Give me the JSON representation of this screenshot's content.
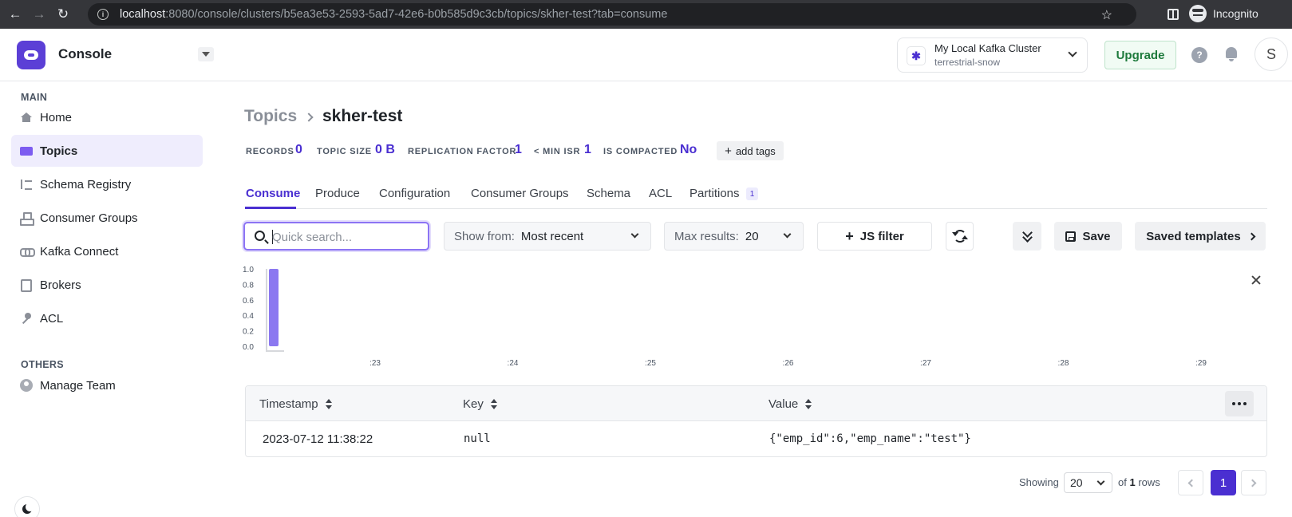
{
  "browser": {
    "url_host": "localhost",
    "url_rest": ":8080/console/clusters/b5ea3e53-2593-5ad7-42e6-b0b585d9c3cb/topics/skher-test?tab=consume",
    "profile_label": "Incognito"
  },
  "app": {
    "name": "Console",
    "cluster_name": "My Local Kafka Cluster",
    "cluster_sub": "terrestrial-snow",
    "upgrade_label": "Upgrade",
    "user_initial": "S",
    "accent": "#4a2fd1"
  },
  "sidebar": {
    "main_label": "MAIN",
    "items": [
      {
        "label": "Home",
        "icon": "home-icon"
      },
      {
        "label": "Topics",
        "icon": "topics-icon",
        "active": true
      },
      {
        "label": "Schema Registry",
        "icon": "schema-registry-icon"
      },
      {
        "label": "Consumer Groups",
        "icon": "consumer-groups-icon"
      },
      {
        "label": "Kafka Connect",
        "icon": "kafka-connect-icon"
      },
      {
        "label": "Brokers",
        "icon": "brokers-icon"
      },
      {
        "label": "ACL",
        "icon": "key-icon"
      }
    ],
    "others_label": "OTHERS",
    "others_items": [
      {
        "label": "Manage Team",
        "icon": "team-icon"
      }
    ]
  },
  "page": {
    "breadcrumb_root": "Topics",
    "title": "skher-test",
    "stats": [
      {
        "label": "RECORDS",
        "value": "0"
      },
      {
        "label": "TOPIC SIZE",
        "value": "0 B"
      },
      {
        "label": "REPLICATION FACTOR",
        "value": "1"
      },
      {
        "label": "< MIN ISR",
        "value": "1"
      },
      {
        "label": "IS COMPACTED",
        "value": "No"
      }
    ],
    "add_tags_label": "add tags",
    "tabs": [
      {
        "label": "Consume",
        "active": true
      },
      {
        "label": "Produce"
      },
      {
        "label": "Configuration"
      },
      {
        "label": "Consumer Groups"
      },
      {
        "label": "Schema"
      },
      {
        "label": "ACL"
      },
      {
        "label": "Partitions",
        "badge": "1"
      }
    ]
  },
  "toolbar": {
    "search_placeholder": "Quick search...",
    "show_from_label": "Show from:",
    "show_from_value": "Most recent",
    "max_results_label": "Max results:",
    "max_results_value": "20",
    "js_filter_label": "JS filter",
    "save_label": "Save",
    "saved_templates_label": "Saved templates"
  },
  "chart_data": {
    "type": "bar",
    "x_ticks": [
      ":23",
      ":24",
      ":25",
      ":26",
      ":27",
      ":28",
      ":29"
    ],
    "y_ticks": [
      "1.0",
      "0.8",
      "0.6",
      "0.4",
      "0.2",
      "0.0"
    ],
    "ylim": [
      0,
      1
    ],
    "bars": [
      {
        "x_position": 0.0,
        "value": 1.0
      }
    ],
    "bar_color": "#8b78f0",
    "grid": false
  },
  "table": {
    "columns": [
      "Timestamp",
      "Key",
      "Value"
    ],
    "rows": [
      {
        "timestamp": "2023-07-12 11:38:22",
        "key": "null",
        "value": "{\"emp_id\":6,\"emp_name\":\"test\"}"
      }
    ]
  },
  "pagination": {
    "showing_label": "Showing",
    "page_size": "20",
    "of_label": "of",
    "total": "1",
    "rows_label": "rows",
    "current_page": "1"
  }
}
